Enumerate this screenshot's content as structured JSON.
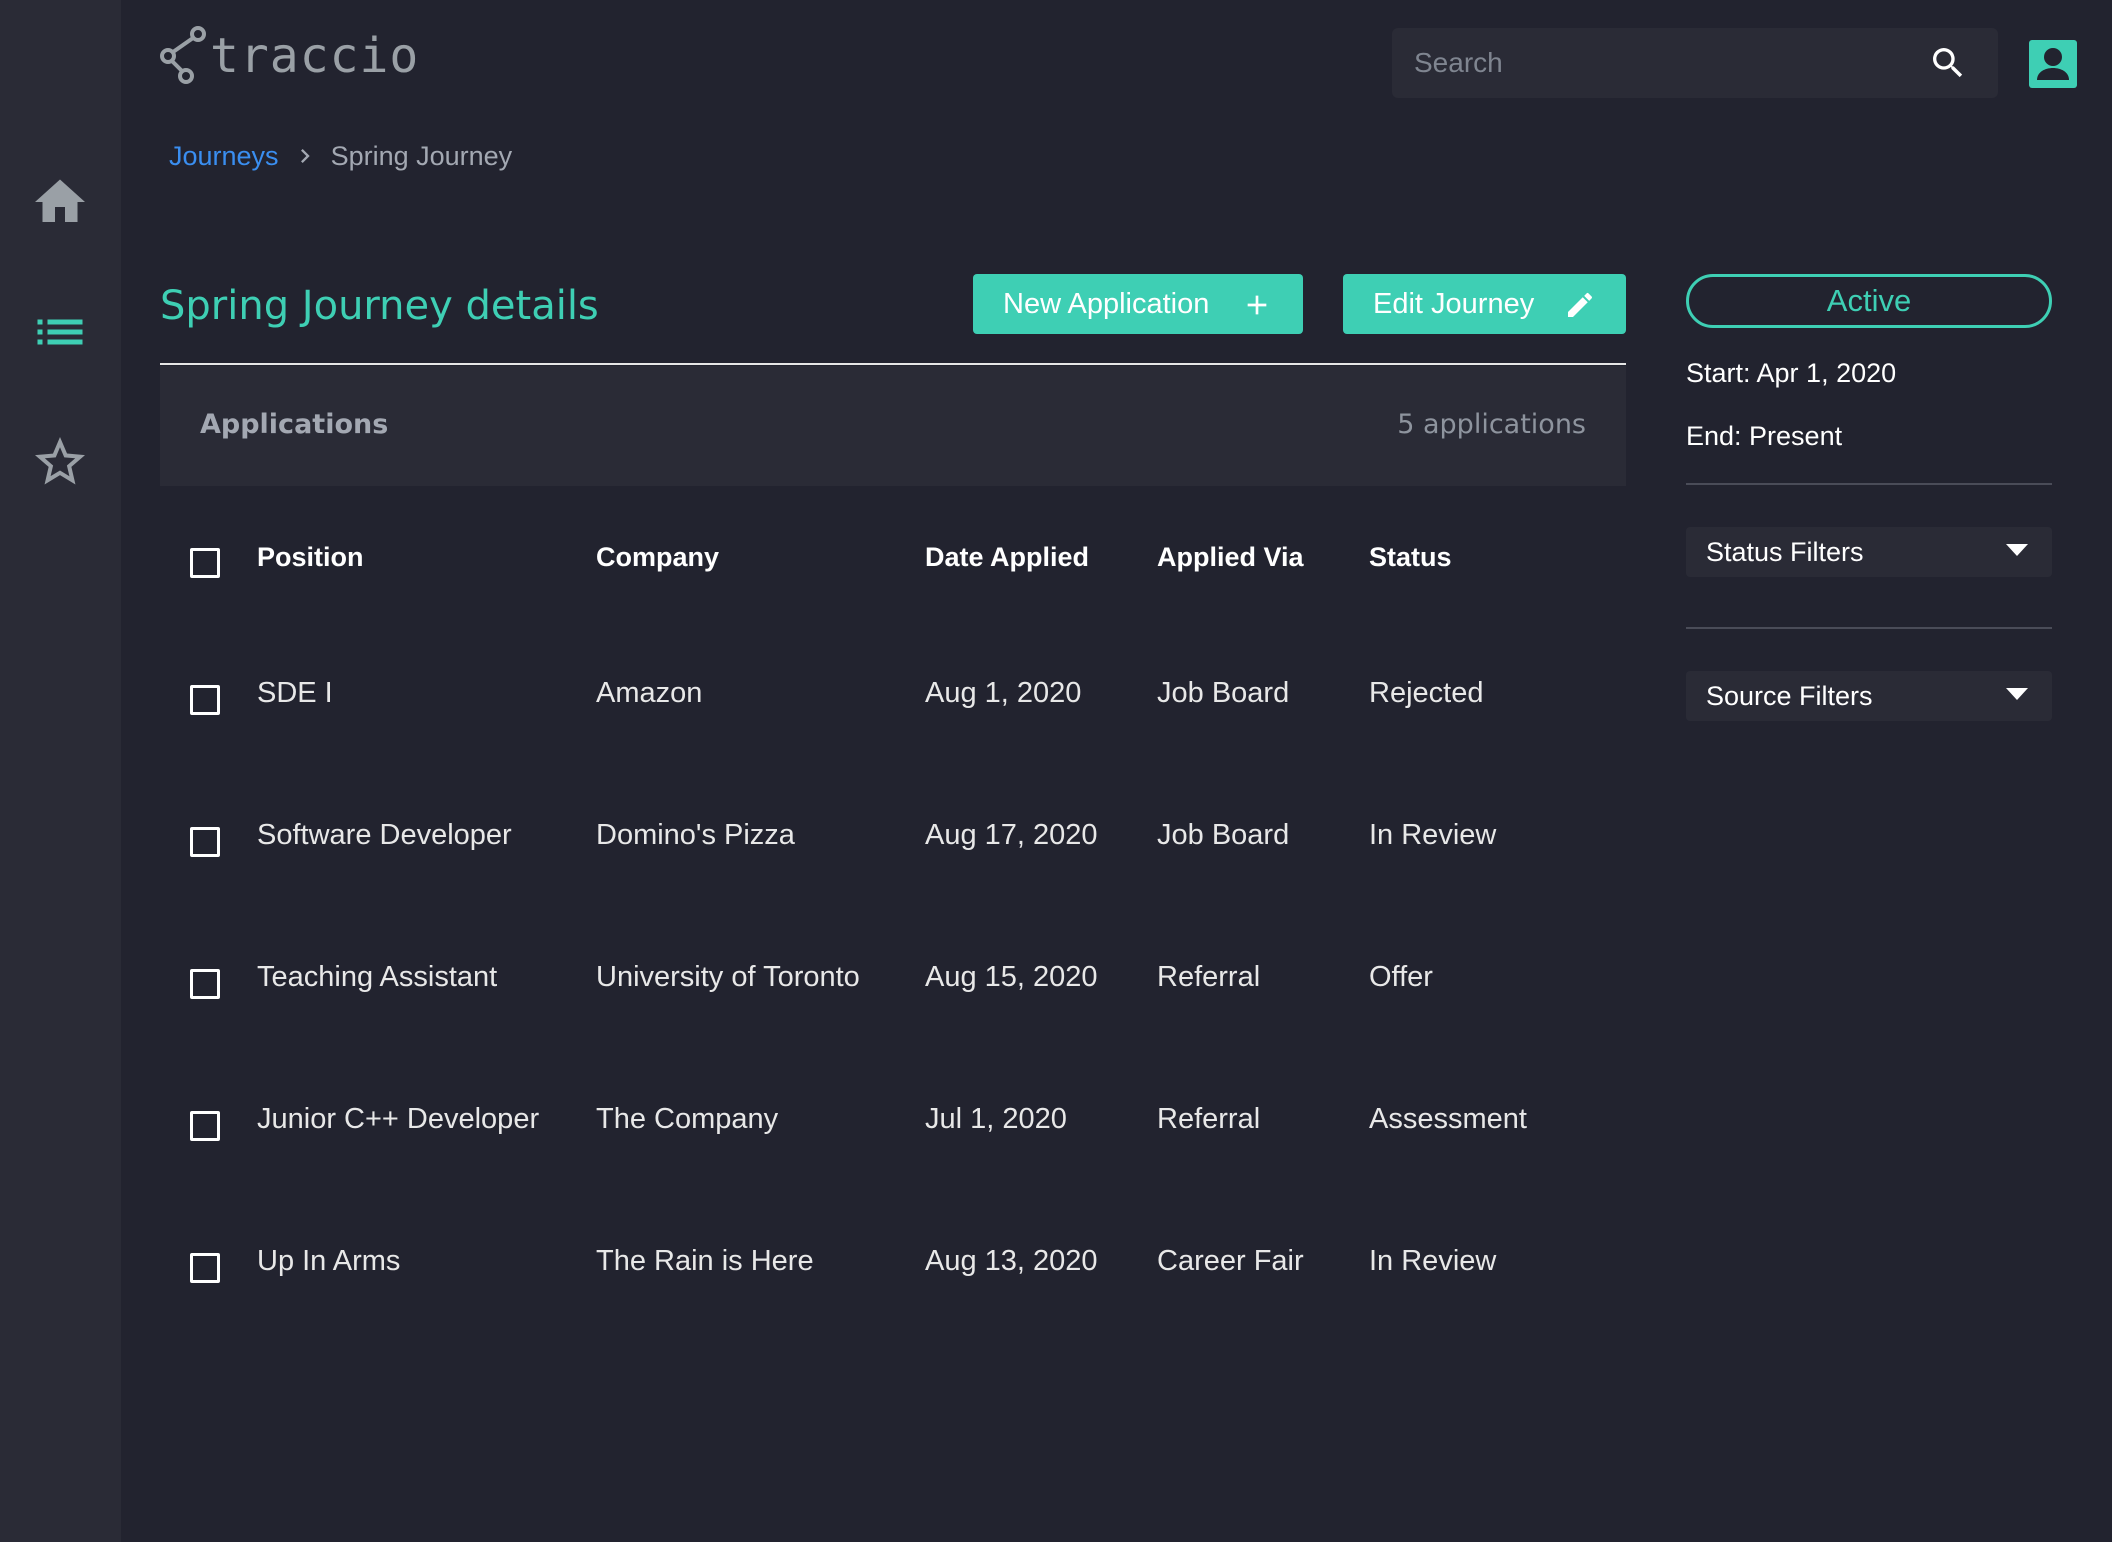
{
  "app": {
    "logo_text": "traccio"
  },
  "search": {
    "placeholder": "Search"
  },
  "sidebar": {
    "items": [
      {
        "icon": "home-icon"
      },
      {
        "icon": "list-icon"
      },
      {
        "icon": "star-icon"
      }
    ]
  },
  "breadcrumb": {
    "parent": "Journeys",
    "current": "Spring Journey"
  },
  "page": {
    "title": "Spring Journey details",
    "new_application_label": "New Application",
    "edit_journey_label": "Edit Journey"
  },
  "applications": {
    "label": "Applications",
    "count_text": "5 applications",
    "columns": [
      "Position",
      "Company",
      "Date Applied",
      "Applied Via",
      "Status"
    ],
    "rows": [
      {
        "position": "SDE I",
        "company": "Amazon",
        "date": "Aug 1, 2020",
        "via": "Job Board",
        "status": "Rejected"
      },
      {
        "position": "Software Developer",
        "company": "Domino's Pizza",
        "date": "Aug 17, 2020",
        "via": "Job Board",
        "status": "In Review"
      },
      {
        "position": "Teaching Assistant",
        "company": "University of Toronto",
        "date": "Aug 15, 2020",
        "via": "Referral",
        "status": "Offer"
      },
      {
        "position": "Junior C++ Developer",
        "company": "The Company",
        "date": "Jul 1, 2020",
        "via": "Referral",
        "status": "Assessment"
      },
      {
        "position": "Up In Arms",
        "company": "The Rain is Here",
        "date": "Aug 13, 2020",
        "via": "Career Fair",
        "status": "In Review"
      }
    ]
  },
  "journey": {
    "status": "Active",
    "start": "Start: Apr 1, 2020",
    "end": "End: Present"
  },
  "filters": {
    "status_label": "Status Filters",
    "source_label": "Source Filters"
  },
  "colors": {
    "accent": "#3ecfb4",
    "link": "#3a8ef0",
    "background": "#22232f",
    "panel": "#2a2b36"
  }
}
